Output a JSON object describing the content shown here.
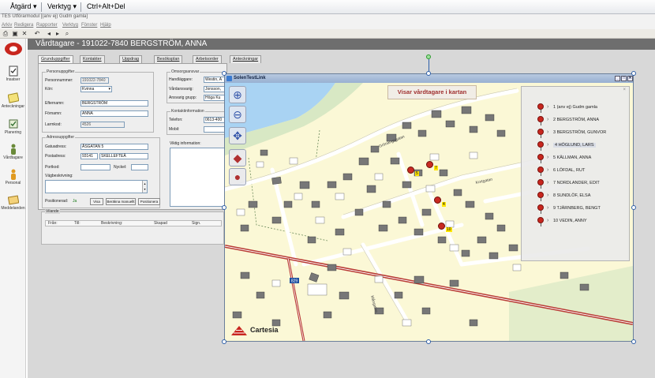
{
  "topbar": {
    "menu1": "Åtgärd",
    "menu2": "Verktyg",
    "shortcut": "Ctrl+Alt+Del"
  },
  "app": {
    "title": "TES Utförarmodul  [(anv ej) Gudm gamla]",
    "menu": [
      "Arkiv",
      "Redigera",
      "Rapporter",
      "Verktyg",
      "Fönster",
      "Hjälp"
    ]
  },
  "sidebar": {
    "items": [
      {
        "label": "Insatser",
        "icon": "clipboard-icon"
      },
      {
        "label": "Anteckningar",
        "icon": "note-icon"
      },
      {
        "label": "Planering",
        "icon": "calendar-icon"
      },
      {
        "label": "Vårdtagare",
        "icon": "person-icon"
      },
      {
        "label": "Personal",
        "icon": "staff-icon"
      },
      {
        "label": "Meddelanden",
        "icon": "envelope-icon"
      }
    ]
  },
  "header": {
    "title": "Vårdtagare - 191022-7840 BERGSTRÖM, ANNA"
  },
  "tabs": [
    "Grunduppgifter",
    "Kontakter",
    "Uppdrag",
    "Besöksplan",
    "Arbetsorder",
    "Anteckningar"
  ],
  "personal": {
    "legend": "Personuppgifter",
    "personnummer_label": "Personnummer:",
    "personnummer": "191022-7840",
    "kon_label": "Kön:",
    "kon": "Kvinna",
    "efternamn_label": "Efternamn:",
    "efternamn": "BERGSTRÖM",
    "fornamn_label": "Förnamn:",
    "fornamn": "ANNA",
    "larmkod_label": "Larmkod:",
    "larmkod": "4526"
  },
  "omsorg": {
    "legend": "Omsorgsansvar",
    "handlaggare_label": "Handläggare:",
    "handlaggare": "Westin, A",
    "vardansvarig_label": "Vårdansvarig:",
    "vardansvarig": "Jonsson,",
    "ansvarig_grupp_label": "Ansvarig grupp:",
    "ansvarig_grupp": "Höga Ku"
  },
  "kontakt": {
    "legend": "Kontaktinformation",
    "telefon_label": "Telefon:",
    "telefon": "0613-400",
    "mobil_label": "Mobil:",
    "mobil": ""
  },
  "adress": {
    "legend": "Adressuppgifter",
    "gatuadress_label": "Gatuadress:",
    "gatuadress": "ÅSGATAN 5",
    "postadress_label": "Postadress:",
    "postnummer": "93141",
    "ort": "SKELLEFTEÅ",
    "portkod_label": "Portkod:",
    "portkod": "",
    "nyckel_label": "Nyckel:",
    "nyckel": "",
    "vagbeskrivning_label": "Vägbeskrivning:",
    "positionerad_label": "Positionerad:",
    "positionerad": "Ja",
    "visa_button": "Visa",
    "berakna_button": "Beräkna manuellt",
    "positionera_button": "Positionera"
  },
  "viktig": {
    "label": "Viktig information:"
  },
  "vilande": {
    "legend": "Vilande",
    "columns": [
      "Från:",
      "Till:",
      "Beskrivning:",
      "Skapad",
      "Sign."
    ]
  },
  "mapwindow": {
    "title": "SolenTestLink",
    "banner": "Visar vårdtagare i kartan",
    "logo": "Cartesia",
    "road_sign": "829",
    "streets": [
      "Grönängsgatan",
      "Kortgatan",
      "Mångatan"
    ],
    "persons": [
      {
        "label": "1 (anv ej) Gudm gamla",
        "selected": false
      },
      {
        "label": "2 BERGSTRÖM, ANNA",
        "selected": false
      },
      {
        "label": "3 BERGSTRÖM, GUNVOR",
        "selected": false
      },
      {
        "label": "4 HÖGLUND, LARS",
        "selected": true
      },
      {
        "label": "5 KÄLLMAN, ANNA",
        "selected": false
      },
      {
        "label": "6 LÖFDAL, RUT",
        "selected": false
      },
      {
        "label": "7 NORDLANDER, EDIT",
        "selected": false
      },
      {
        "label": "8 SUNDLÖF, ELSA",
        "selected": false
      },
      {
        "label": "9 TJÄRNBERG, BENGT",
        "selected": false
      },
      {
        "label": "10 VEDIN, ANNY",
        "selected": false
      }
    ],
    "markers": [
      "5",
      "7",
      "4",
      "10"
    ]
  },
  "colors": {
    "header_bg": "#6e6e6e",
    "map_land": "#fbf8d6",
    "map_water": "#a9d3f3",
    "map_green": "#d8e8c4",
    "marker": "#c82a22",
    "banner_text": "#a03030"
  }
}
